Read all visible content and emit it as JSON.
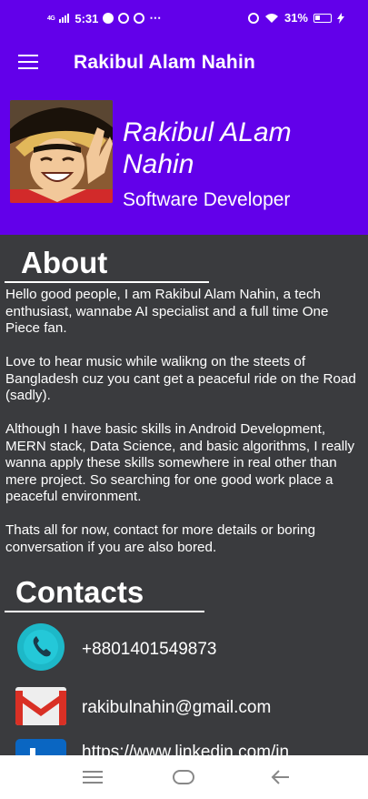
{
  "status_bar": {
    "network": "4G",
    "time": "5:31",
    "dots": "⋯",
    "battery": "31%"
  },
  "app_bar": {
    "title": "Rakibul Alam Nahin"
  },
  "profile": {
    "name": "Rakibul ALam Nahin",
    "role": "Software Developer"
  },
  "about": {
    "title": "About",
    "paragraphs": [
      "Hello good people, I am Rakibul Alam Nahin, a tech enthusiast, wannabe AI specialist and a full time One Piece fan.",
      " Love to hear music while walikng on the steets of Bangladesh cuz you cant get a peaceful ride on the Road (sadly).",
      " Although I have basic skills in Android Development, MERN stack, Data Science, and basic algorithms, I really wanna apply these skills somewhere in real other than mere project. So searching for one good work place a peaceful environment.",
      "Thats all for now, contact for more details or boring conversation if you are also bored."
    ]
  },
  "contacts": {
    "title": "Contacts",
    "items": [
      {
        "icon": "phone-icon",
        "text": "+8801401549873"
      },
      {
        "icon": "gmail-icon",
        "text": "rakibulnahin@gmail.com"
      },
      {
        "icon": "linkedin-icon",
        "text": "https://www.linkedin.com/in"
      }
    ]
  },
  "colors": {
    "primary": "#6200ea",
    "background": "#3a3b3e",
    "text": "#ffffff"
  }
}
